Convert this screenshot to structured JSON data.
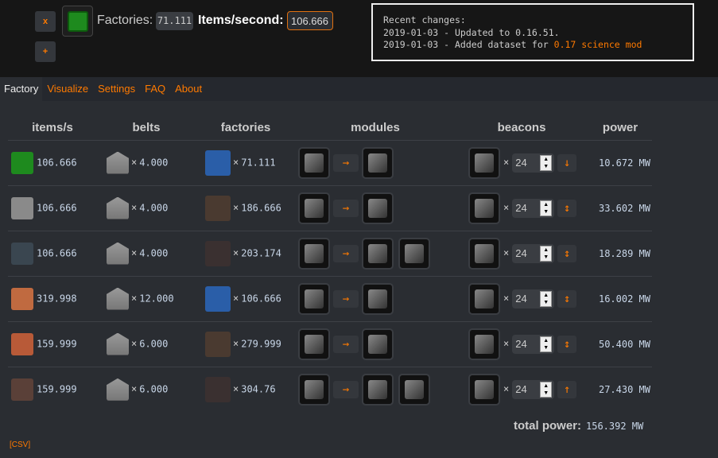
{
  "header": {
    "remove_label": "x",
    "add_label": "+",
    "target_item_icon": "electronic-circuit-icon",
    "factories_label": "Factories:",
    "factories_value": "71.111",
    "rate_label": "Items/second:",
    "rate_value": "106.666"
  },
  "news": {
    "title": "Recent changes:",
    "line1": "2019-01-03 - Updated to 0.16.51.",
    "line2_prefix": "2019-01-03 - Added dataset for ",
    "line2_link": "0.17 science mod"
  },
  "tabs": [
    "Factory",
    "Visualize",
    "Settings",
    "FAQ",
    "About"
  ],
  "table": {
    "headers": [
      "items/s",
      "belts",
      "factories",
      "modules",
      "beacons",
      "power"
    ],
    "rows": [
      {
        "item": "electronic-circuit",
        "color": "#1e8a1e",
        "rate": "106.666",
        "belts": "4.000",
        "factory": "assembling-machine",
        "fcolor": "#2a5ea8",
        "factories": "71.111",
        "modules": 1,
        "beacons": "24",
        "beacon_arrow": "↓",
        "power": "10.672 MW"
      },
      {
        "item": "iron-plate",
        "color": "#8a8a8a",
        "rate": "106.666",
        "belts": "4.000",
        "factory": "electric-furnace",
        "fcolor": "#4a3a30",
        "factories": "186.666",
        "modules": 1,
        "beacons": "24",
        "beacon_arrow": "↕",
        "power": "33.602 MW"
      },
      {
        "item": "iron-ore",
        "color": "#3a4650",
        "rate": "106.666",
        "belts": "4.000",
        "factory": "mining-drill",
        "fcolor": "#3a3030",
        "factories": "203.174",
        "modules": 2,
        "beacons": "24",
        "beacon_arrow": "↕",
        "power": "18.289 MW"
      },
      {
        "item": "copper-cable",
        "color": "#c06a40",
        "rate": "319.998",
        "belts": "12.000",
        "factory": "assembling-machine",
        "fcolor": "#2a5ea8",
        "factories": "106.666",
        "modules": 1,
        "beacons": "24",
        "beacon_arrow": "↕",
        "power": "16.002 MW"
      },
      {
        "item": "copper-plate",
        "color": "#b85a38",
        "rate": "159.999",
        "belts": "6.000",
        "factory": "electric-furnace",
        "fcolor": "#4a3a30",
        "factories": "279.999",
        "modules": 1,
        "beacons": "24",
        "beacon_arrow": "↕",
        "power": "50.400 MW"
      },
      {
        "item": "copper-ore",
        "color": "#5a4038",
        "rate": "159.999",
        "belts": "6.000",
        "factory": "mining-drill",
        "fcolor": "#3a3030",
        "factories": "304.76",
        "modules": 2,
        "beacons": "24",
        "beacon_arrow": "↑",
        "power": "27.430 MW"
      }
    ]
  },
  "footer": {
    "total_label": "total power:",
    "total_value": "156.392 MW",
    "csv_label": "[CSV]"
  },
  "colors": {
    "accent": "#ff7a00",
    "background": "#2a2d32"
  }
}
